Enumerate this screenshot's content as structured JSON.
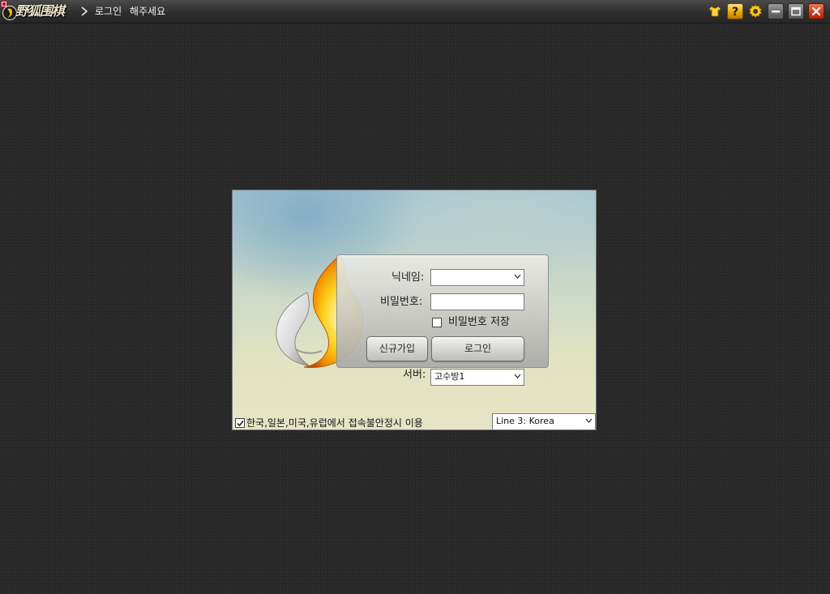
{
  "titlebar": {
    "app_name": "野狐围棋",
    "breadcrumb": [
      "로그인",
      "해주세요"
    ],
    "icons": [
      "shirt-icon",
      "help-icon",
      "gear-icon",
      "minimize-icon",
      "maximize-icon",
      "close-icon"
    ],
    "colors": {
      "accent_gold": "#e0a400",
      "close_red": "#d43c1a"
    }
  },
  "login": {
    "nickname_label": "닉네임:",
    "nickname_value": "",
    "password_label": "비밀번호:",
    "password_value": "",
    "save_password_label": "비밀번호 저장",
    "save_password_checked": false,
    "signup_button": "신규가입",
    "login_button": "로그인",
    "server_label": "서버:",
    "server_value": "고수방1",
    "connection_note": "한국,일본,미국,유럽에서 접속불안정시 이용",
    "connection_note_checked": true,
    "line_value": "Line 3: Korea"
  }
}
